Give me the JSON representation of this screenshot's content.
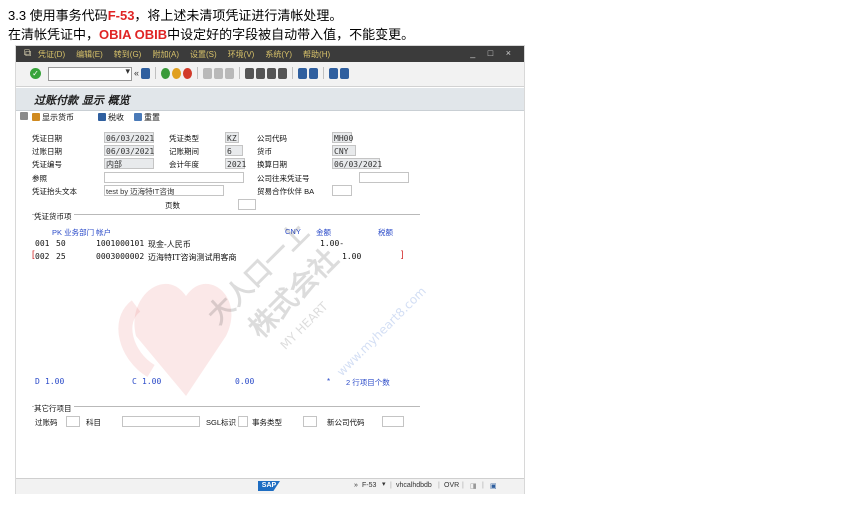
{
  "intro": {
    "line1_prefix": "3.3 使用事务代码",
    "line1_code": "F-53",
    "line1_suffix": "，将上述未清项凭证进行清帐处理。",
    "line2_prefix": "在清帐凭证中，",
    "line2_code": "OBIA OBIB",
    "line2_suffix": "中设定好的字段被自动带入值，不能变更。"
  },
  "menubar": {
    "items": [
      "凭证(D)",
      "编辑(E)",
      "转到(G)",
      "附加(A)",
      "设置(S)",
      "环境(V)",
      "系统(Y)",
      "帮助(H)"
    ],
    "controls": "_ □ ×"
  },
  "toolbar": {
    "command_value": "",
    "nav_prev": "«"
  },
  "screen_title": "过账付款 显示 概览",
  "app_toolbar": {
    "show_currency": "显示货币",
    "tax": "税收",
    "reset": "重置"
  },
  "header": {
    "doc_date_label": "凭证日期",
    "doc_date": "06/03/2021",
    "doc_type_label": "凭证类型",
    "doc_type": "KZ",
    "company_code_label": "公司代码",
    "company_code": "MH00",
    "posting_date_label": "过账日期",
    "posting_date": "06/03/2021",
    "period_label": "记账期间",
    "period": "6",
    "currency_label": "货币",
    "currency": "CNY",
    "doc_number_label": "凭证编号",
    "doc_number": "内部",
    "fiscal_year_label": "会计年度",
    "fiscal_year": "2021",
    "translation_date_label": "换算日期",
    "translation_date": "06/03/2021",
    "reference_label": "参照",
    "reference": "",
    "cross_cc_label": "公司往来凭证号",
    "cross_cc": "",
    "header_text_label": "凭证抬头文本",
    "header_text": "test by 迈海特IT咨询",
    "trading_partner_label": "贸易合作伙伴 BA",
    "trading_partner": "",
    "pages_label": "页数",
    "pages": ""
  },
  "items_section": {
    "title": "凭证货币项",
    "col_pk_dept_account": "PK 业务部门 帐户",
    "col_currency": "CNY",
    "col_amount": "金额",
    "col_tax_code": "税额",
    "rows": [
      {
        "no": "001",
        "pk": "50",
        "account": "1001000101",
        "text": "现金-人民币",
        "amount": "1.00-"
      },
      {
        "no": "002",
        "pk": "25",
        "account": "0003000002",
        "text": "迈海特IT咨询测试用客商",
        "amount": "1.00"
      }
    ]
  },
  "totals": {
    "d_label": "D",
    "d_value": "1.00",
    "c_label": "C",
    "c_value": "1.00",
    "balance": "0.00",
    "star": "*",
    "count_text": "2 行项目个数"
  },
  "other_section": {
    "title": "其它行项目",
    "posting_key_label": "过账码",
    "posting_key": "",
    "account_label": "科目",
    "account": "",
    "sgl_label": "SGL标识",
    "sgl": "",
    "trans_type_label": "事务类型",
    "trans_type": "",
    "new_cc_label": "新公司代码",
    "new_cc": ""
  },
  "statusbar": {
    "sap_logo": "SAP",
    "nav": "»",
    "tcode": "F-53",
    "server": "vhcalhdbdb",
    "mode": "OVR"
  },
  "watermark": {
    "cn": "大人口一上",
    "cn2": "株式会社",
    "en": "MY HEART",
    "url": "www.myheart8.com"
  },
  "colors": {
    "accent_red": "#e02424",
    "menubar": "#3b3b3b",
    "title_bg": "#e1e6ea",
    "blue_text": "#2b4bc9"
  }
}
